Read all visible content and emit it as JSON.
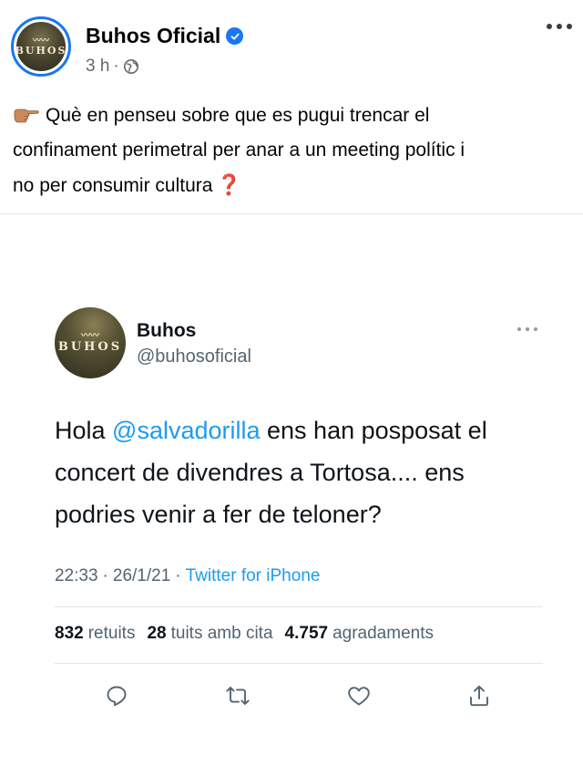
{
  "post": {
    "page_name": "Buhos Oficial",
    "time": "3 h",
    "dot": "·",
    "avatar_text": "BUHOS",
    "text_line1": "Què en penseu sobre que es pugui trencar el",
    "text_line2": "confinament perimetral per anar a un meeting polític i",
    "text_line3": "no per consumir cultura",
    "end_mark": "❓",
    "icons": [
      "verified-badge-icon",
      "globe-icon",
      "more-options-icon",
      "pointing-hand-emoji"
    ]
  },
  "tweet": {
    "avatar_text": "BUHOS",
    "display_name": "Buhos",
    "handle": "@buhosoficial",
    "text_before": "Hola ",
    "mention": "@salvadorilla",
    "text_after": " ens han posposat el concert de divendres a Tortosa.... ens podries venir a fer de teloner?",
    "time": "22:33",
    "sep": "·",
    "date": "26/1/21",
    "source": "Twitter for iPhone",
    "stats": {
      "retweets_count": "832",
      "retweets_label": "retuits",
      "quotes_count": "28",
      "quotes_label": "tuits amb cita",
      "likes_count": "4.757",
      "likes_label": "agradaments"
    },
    "actions": [
      "reply-icon",
      "retweet-icon",
      "like-icon",
      "share-icon"
    ]
  },
  "colors": {
    "facebook_blue": "#1877f2",
    "twitter_blue": "#1d9bf0",
    "secondary_text": "#536471",
    "question_mark_red": "#d0021b"
  }
}
